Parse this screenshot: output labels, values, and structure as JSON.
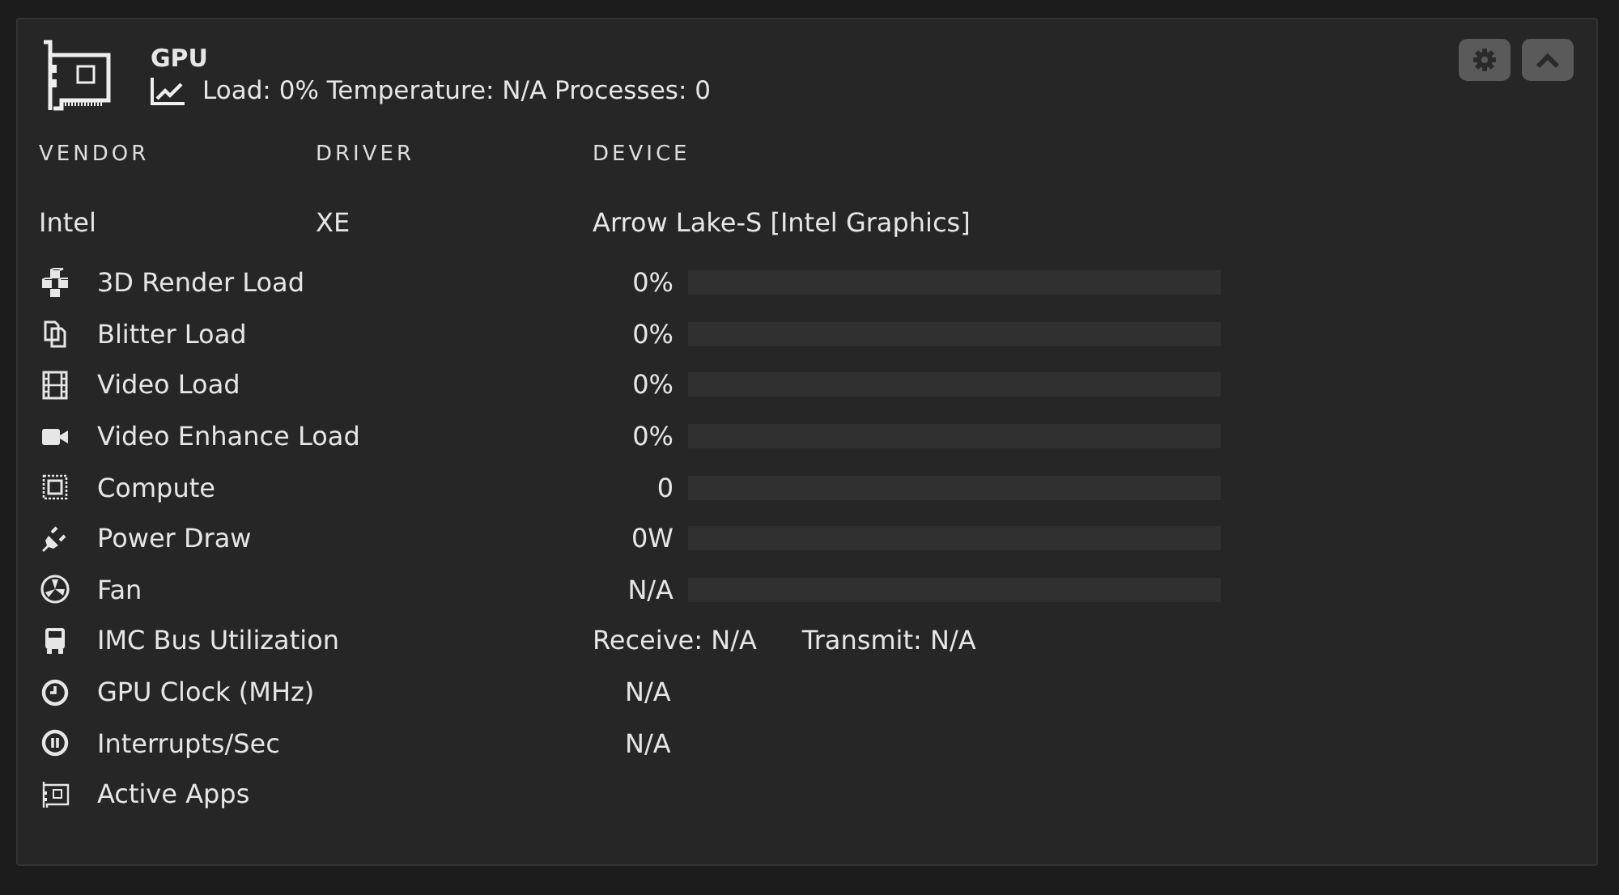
{
  "header": {
    "title": "GPU",
    "summary": "Load: 0% Temperature: N/A Processes: 0"
  },
  "buttons": {
    "settings": {
      "disabled": false
    },
    "collapse": {
      "expanded": true
    }
  },
  "columns": [
    "VENDOR",
    "DRIVER",
    "DEVICE"
  ],
  "info": [
    "Intel",
    "XE",
    "Arrow Lake-S [Intel Graphics]"
  ],
  "metrics": [
    {
      "kind": "bar",
      "label": "3D Render Load",
      "value": "0%",
      "level": 0
    },
    {
      "kind": "bar",
      "label": "Blitter Load",
      "value": "0%",
      "level": 0
    },
    {
      "kind": "bar",
      "label": "Video Load",
      "value": "0%",
      "level": 0
    },
    {
      "kind": "bar",
      "label": "Video Enhance Load",
      "value": "0%",
      "level": 0
    },
    {
      "kind": "bar",
      "label": "Compute",
      "value": "0",
      "level": 0
    },
    {
      "kind": "bar",
      "label": "Power Draw",
      "value": "0W",
      "level": 0
    },
    {
      "kind": "bar",
      "label": "Fan",
      "value": "N/A",
      "level": 0
    },
    {
      "kind": "pair",
      "label": "IMC Bus Utilization",
      "receive": "Receive: N/A",
      "transmit": "Transmit: N/A"
    },
    {
      "kind": "value",
      "label": "GPU Clock (MHz)",
      "value": "N/A"
    },
    {
      "kind": "value",
      "label": "Interrupts/Sec",
      "value": "N/A"
    },
    {
      "kind": "plain",
      "label": "Active Apps"
    }
  ]
}
